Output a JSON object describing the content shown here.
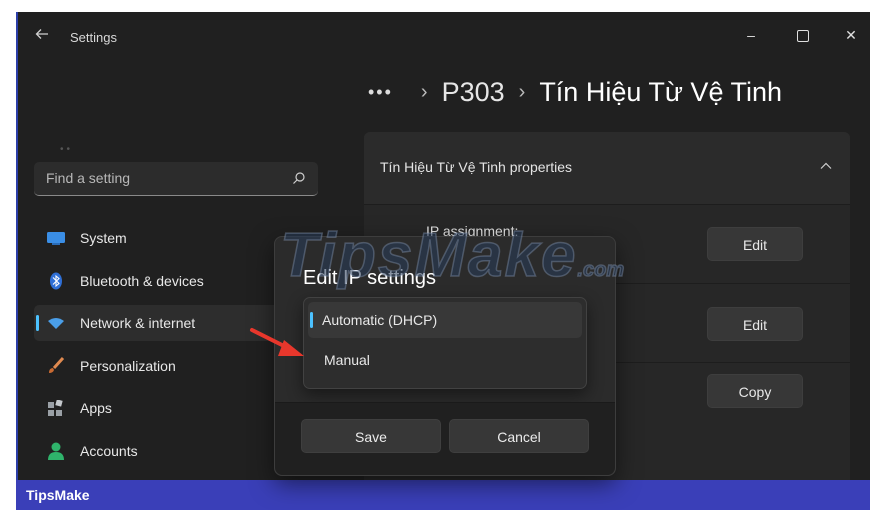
{
  "window": {
    "app_title": "Settings",
    "back_icon": "arrow-left-icon",
    "controls": {
      "minimize": "–",
      "close": "✕"
    }
  },
  "breadcrumb": {
    "more": "•••",
    "separator": "›",
    "items": [
      "P303",
      "Tín Hiệu Từ Vệ Tinh"
    ]
  },
  "search": {
    "placeholder": "Find a setting",
    "icon": "search-icon"
  },
  "sidebar": {
    "items": [
      {
        "label": "System",
        "icon": "monitor-icon",
        "color": "#3a8ee6",
        "selected": false
      },
      {
        "label": "Bluetooth & devices",
        "icon": "bluetooth-icon",
        "color": "#2f6fd6",
        "selected": false
      },
      {
        "label": "Network & internet",
        "icon": "wifi-icon",
        "color": "#4a9ee8",
        "selected": true
      },
      {
        "label": "Personalization",
        "icon": "brush-icon",
        "color": "#e08a50",
        "selected": false
      },
      {
        "label": "Apps",
        "icon": "apps-icon",
        "color": "#9aa0a6",
        "selected": false
      },
      {
        "label": "Accounts",
        "icon": "person-icon",
        "color": "#2fb36b",
        "selected": false
      }
    ]
  },
  "properties": {
    "title": "Tín Hiệu Từ Vệ Tinh properties",
    "rows": [
      {
        "label": "IP assignment:",
        "button": "Edit"
      },
      {
        "label": "",
        "button": "Edit"
      },
      {
        "label": "",
        "button": "Copy"
      }
    ]
  },
  "dialog": {
    "title": "Edit IP settings",
    "options": [
      "Automatic (DHCP)",
      "Manual"
    ],
    "selected_option": "Automatic (DHCP)",
    "save_label": "Save",
    "cancel_label": "Cancel"
  },
  "watermark": {
    "text": "TipsMake",
    "suffix": ".com"
  },
  "brand": {
    "text": "TipsMake",
    "bar_color": "#3a3fb8"
  },
  "colors": {
    "accent": "#4cc2ff",
    "annotation_arrow": "#e8372c"
  }
}
